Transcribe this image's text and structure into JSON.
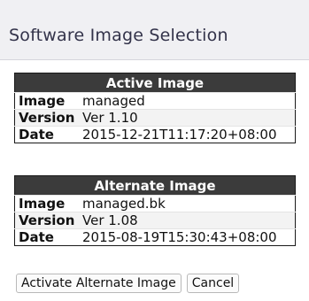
{
  "page": {
    "title": "Software Image Selection"
  },
  "active_image": {
    "header": "Active Image",
    "rows": [
      {
        "label": "Image",
        "value": "managed"
      },
      {
        "label": "Version",
        "value": "Ver 1.10"
      },
      {
        "label": "Date",
        "value": "2015-12-21T11:17:20+08:00"
      }
    ]
  },
  "alternate_image": {
    "header": "Alternate Image",
    "rows": [
      {
        "label": "Image",
        "value": "managed.bk"
      },
      {
        "label": "Version",
        "value": "Ver 1.08"
      },
      {
        "label": "Date",
        "value": "2015-08-19T15:30:43+08:00"
      }
    ]
  },
  "buttons": {
    "activate_label": "Activate Alternate Image",
    "cancel_label": "Cancel"
  },
  "colors": {
    "header_bg": "#3b3b3b",
    "title_bar_bg": "#f0f0f3",
    "title_text": "#33334a"
  }
}
